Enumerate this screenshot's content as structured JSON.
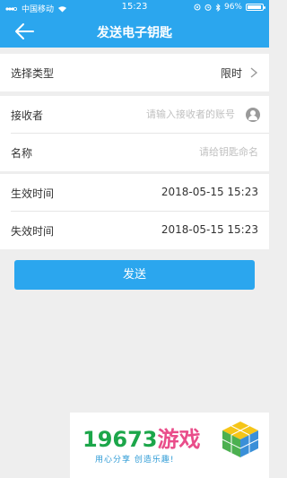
{
  "status_bar": {
    "carrier": "中国移动",
    "time": "15:23",
    "battery": "96%",
    "battery_level": 0.96
  },
  "nav": {
    "title": "发送电子钥匙"
  },
  "form": {
    "type": {
      "label": "选择类型",
      "value": "限时"
    },
    "recipient": {
      "label": "接收者",
      "placeholder": "请输入接收者的账号"
    },
    "name": {
      "label": "名称",
      "placeholder": "请给钥匙命名"
    },
    "start": {
      "label": "生效时间",
      "value": "2018-05-15 15:23"
    },
    "end": {
      "label": "失效时间",
      "value": "2018-05-15 15:23"
    }
  },
  "send_button": "发送",
  "watermark": {
    "brand_number": "19673",
    "brand_game": "游戏",
    "slogan": "用心分享 创造乐趣!"
  },
  "colors": {
    "primary": "#2ba6ee",
    "background": "#eeeeee",
    "watermark_green": "#1ca64a",
    "watermark_pink": "#e94d8a"
  }
}
